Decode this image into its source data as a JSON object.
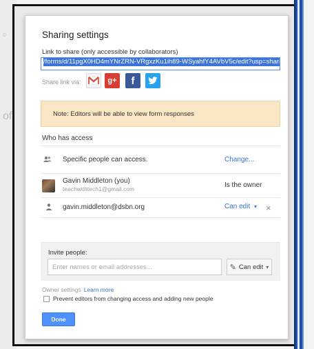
{
  "dialog": {
    "title": "Sharing settings",
    "link_label": "Link to share (only accessible by collaborators)",
    "link_value": "/forms/d/11pgX0HD4mYNrZRN-VRgxzKu1ih89-WSyahfY4AVbV5c/edit?usp=sharing",
    "share_via_label": "Share link via:",
    "social_icons": [
      "gmail-icon",
      "google-plus-icon",
      "facebook-icon",
      "twitter-icon"
    ],
    "social_glyphs": {
      "gmail": "M",
      "gplus": "g+",
      "facebook": "f",
      "twitter": "🐦"
    },
    "note": "Note: Editors will be able to view form responses"
  },
  "access": {
    "section_title": "Who has access",
    "general": {
      "text": "Specific people can access.",
      "action": "Change..."
    },
    "owner": {
      "name": "Gavin Middleton (you)",
      "email": "teachwithtech1@gmail.com",
      "role": "Is the owner"
    },
    "collaborator": {
      "email": "gavin.middleton@dsbn.org",
      "role": "Can edit",
      "role_caret": "▾",
      "remove": "×"
    }
  },
  "invite": {
    "label": "Invite people:",
    "placeholder": "Enter names or email addresses...",
    "permission": "Can edit",
    "permission_caret": "▾",
    "pencil_glyph": "✎"
  },
  "owner_settings": {
    "label": "Owner settings",
    "learn_more": "Learn more",
    "prevent_editors": "Prevent editors from changing access and adding new people",
    "prevent_editors_checked": false
  },
  "done_label": "Done",
  "background": {
    "frag_o": "o",
    "frag_of": "of"
  },
  "colors": {
    "accent_blue": "#4d90fe",
    "link_blue": "#3b73d6",
    "note_bg": "#f9e6c4",
    "frame_blue": "#1f4fa8"
  }
}
